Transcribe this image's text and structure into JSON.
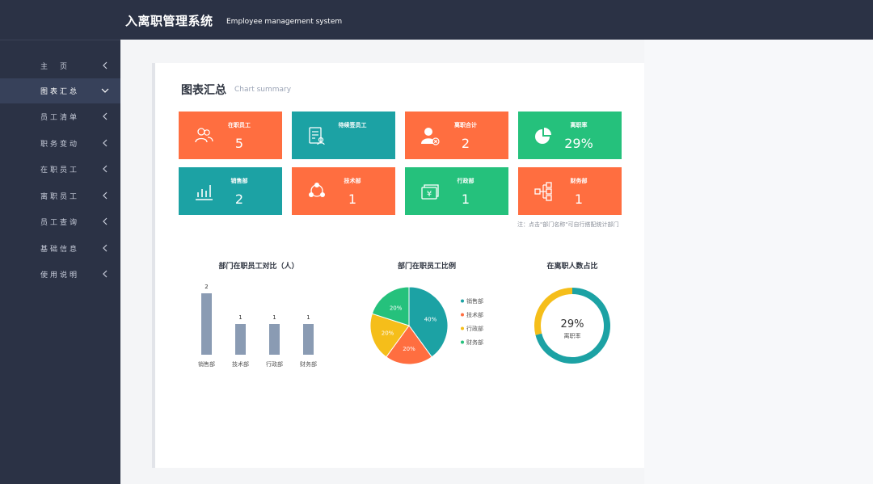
{
  "header": {
    "title": "入离职管理系统",
    "subtitle": "Employee management system"
  },
  "sidebar": {
    "items": [
      {
        "label": "主　页",
        "active": false
      },
      {
        "label": "图表汇总",
        "active": true
      },
      {
        "label": "员工清单",
        "active": false
      },
      {
        "label": "职务变动",
        "active": false
      },
      {
        "label": "在职员工",
        "active": false
      },
      {
        "label": "离职员工",
        "active": false
      },
      {
        "label": "员工查询",
        "active": false
      },
      {
        "label": "基础信息",
        "active": false
      },
      {
        "label": "使用说明",
        "active": false
      }
    ]
  },
  "main": {
    "title": "图表汇总",
    "subtitle": "Chart summary",
    "note": "注：点击\"部门名称\"可自行搭配统计部门",
    "tiles": [
      {
        "label": "在职员工",
        "value": "5",
        "color": "#ff6e40",
        "icon": "users-icon"
      },
      {
        "label": "待续签员工",
        "value": "",
        "color": "#1ca2a4",
        "icon": "contract-icon"
      },
      {
        "label": "离职合计",
        "value": "2",
        "color": "#ff6e40",
        "icon": "user-remove-icon"
      },
      {
        "label": "离职率",
        "value": "29%",
        "color": "#25c17c",
        "icon": "pie-icon"
      },
      {
        "label": "销售部",
        "value": "2",
        "color": "#1ca2a4",
        "icon": "bar-chart-icon"
      },
      {
        "label": "技术部",
        "value": "1",
        "color": "#ff6e40",
        "icon": "network-icon"
      },
      {
        "label": "行政部",
        "value": "1",
        "color": "#25c17c",
        "icon": "money-icon"
      },
      {
        "label": "财务部",
        "value": "1",
        "color": "#ff6e40",
        "icon": "hierarchy-icon"
      }
    ]
  },
  "colors": {
    "header_bg": "#2b3245",
    "orange": "#ff6e40",
    "teal": "#1ca2a4",
    "green": "#25c17c",
    "yellow": "#f5be1a",
    "bar": "#8a9bb3"
  },
  "chart_data": [
    {
      "type": "bar",
      "title": "部门在职员工对比（人）",
      "categories": [
        "销售部",
        "技术部",
        "行政部",
        "财务部"
      ],
      "values": [
        2,
        1,
        1,
        1
      ],
      "ylim": [
        0,
        2
      ],
      "grid": false
    },
    {
      "type": "pie",
      "title": "部门在职员工比例",
      "labels": [
        "销售部",
        "技术部",
        "行政部",
        "财务部"
      ],
      "values": [
        40,
        20,
        20,
        20
      ],
      "value_labels": [
        "40%",
        "20%",
        "20%",
        "20%"
      ],
      "colors": [
        "#1ca2a4",
        "#ff6e40",
        "#f5be1a",
        "#25c17c"
      ],
      "legend": "right"
    },
    {
      "type": "pie",
      "title": "在离职人数占比",
      "center_value": "29%",
      "center_label": "离职率",
      "values": [
        29,
        71
      ],
      "colors": [
        "#f5be1a",
        "#1ca2a4"
      ]
    }
  ]
}
